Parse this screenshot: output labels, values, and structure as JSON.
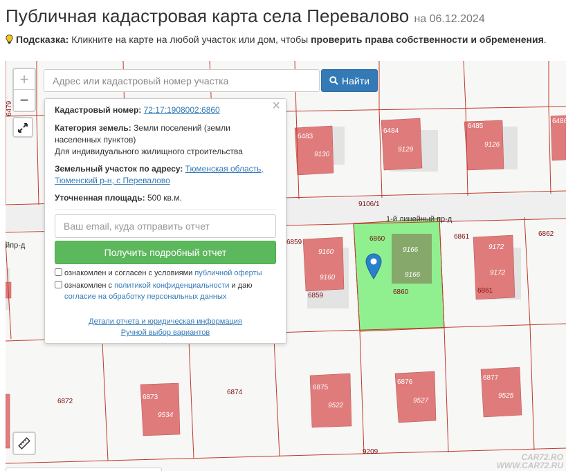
{
  "page": {
    "title": "Публичная кадастровая карта села Перевалово",
    "date": "на 06.12.2024"
  },
  "hint": {
    "label": "Подсказка:",
    "text": "Кликните на карте на любой участок или дом, чтобы",
    "bold_text": "проверить права собственности и обременения",
    "end": "."
  },
  "map": {
    "zoom_in": "+",
    "zoom_out": "−",
    "search": {
      "placeholder": "Адрес или кадастровый номер участка",
      "button_label": "Найти"
    },
    "parcel_labels": [
      "6479",
      "6483",
      "9130",
      "6484",
      "9129",
      "6485",
      "9126",
      "6486",
      "9106/1",
      "1-й линейный пр-д",
      "йпр-д",
      "6859",
      "9160",
      "9160",
      "6859",
      "6860",
      "9166",
      "9166",
      "6860",
      "6861",
      "9172",
      "9172",
      "6861",
      "6862",
      "6872",
      "6873",
      "9534",
      "6874",
      "6875",
      "9522",
      "6876",
      "9527",
      "6877",
      "9525",
      "9209"
    ],
    "selected_fill": "#90f090",
    "building_fill": "#e07b7b"
  },
  "popup": {
    "close": "×",
    "cadastral_label": "Кадастровый номер:",
    "cadastral_value": "72:17:1908002:6860",
    "category_label": "Категория земель:",
    "category_value": "Земли поселений (земли населенных пунктов)",
    "use_value": "Для индивидуального жилищного строительства",
    "address_label": "Земельный участок по адресу:",
    "address_value": "Тюменская область, Тюменский р-н, с Перевалово",
    "area_label": "Уточненная площадь:",
    "area_value": "500 кв.м.",
    "email_placeholder": "Ваш email, куда отправить отчет",
    "report_button": "Получить подробный отчет",
    "check1_text": "ознакомлен и согласен с условиями",
    "check1_link": "публичной оферты",
    "check2_text": "ознакомлен с",
    "check2_link": "политикой конфиденциальности",
    "check2_text2": "и даю",
    "check2_link2": "согласие на обработку персональных данных",
    "details_link": "Детали отчета и юридическая информация",
    "manual_link": "Ручной выбор вариантов"
  },
  "watermark": {
    "line1": "CAR72.RO",
    "line2": "WWW.CAR72.RU"
  }
}
